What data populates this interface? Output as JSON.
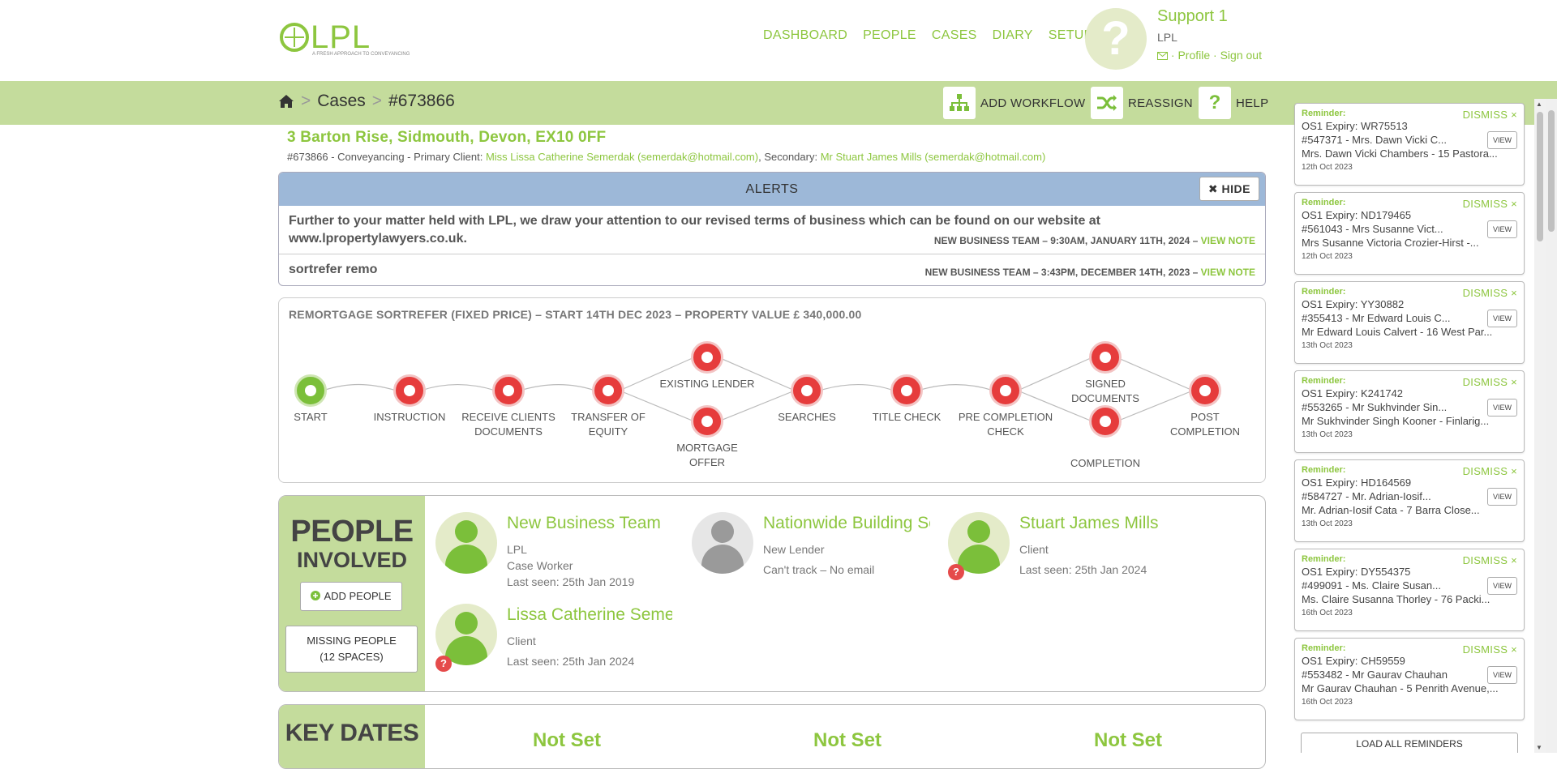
{
  "header": {
    "logo_text": "LPL",
    "logo_tagline": "A FRESH APPROACH TO CONVEYANCING",
    "nav": [
      "DASHBOARD",
      "PEOPLE",
      "CASES",
      "DIARY",
      "SETUP"
    ],
    "user": {
      "name": "Support 1",
      "org": "LPL",
      "profile": "Profile",
      "signout": "Sign out",
      "sep": "·"
    }
  },
  "breadcrumb": {
    "cases": "Cases",
    "case_id": "#673866",
    "sep": ">"
  },
  "actions": {
    "add_workflow": "ADD WORKFLOW",
    "reassign": "REASSIGN",
    "help": "HELP"
  },
  "case": {
    "address": "3 Barton Rise, Sidmouth, Devon, EX10 0FF",
    "sub_prefix": "#673866 - Conveyancing - Primary Client: ",
    "primary": "Miss Lissa Catherine Semerdak (semerdak@hotmail.com)",
    "sub_mid": ", Secondary: ",
    "secondary": "Mr Stuart James Mills (semerdak@hotmail.com)"
  },
  "alerts": {
    "title": "ALERTS",
    "hide": "HIDE",
    "items": [
      {
        "text": "Further to your matter held with LPL, we draw your attention to our revised terms of business which can be found on our website at www.lpropertylawyers.co.uk.",
        "meta": "NEW BUSINESS TEAM – 9:30AM, JANUARY 11TH, 2024 – ",
        "link": "VIEW NOTE"
      },
      {
        "text": "sortrefer remo",
        "meta": "NEW BUSINESS TEAM – 3:43PM, DECEMBER 14TH, 2023 – ",
        "link": "VIEW NOTE"
      }
    ]
  },
  "workflow": {
    "title": "REMORTGAGE SORTREFER (FIXED PRICE) – START 14TH DEC 2023 – PROPERTY VALUE £ 340,000.00",
    "nodes": [
      {
        "label": "START",
        "status": "done"
      },
      {
        "label": "INSTRUCTION",
        "status": "pending"
      },
      {
        "label": "RECEIVE CLIENTS DOCUMENTS",
        "status": "pending"
      },
      {
        "label": "TRANSFER OF EQUITY",
        "status": "pending"
      },
      {
        "label": "EXISTING LENDER",
        "status": "pending"
      },
      {
        "label": "MORTGAGE OFFER",
        "status": "pending"
      },
      {
        "label": "SEARCHES",
        "status": "pending"
      },
      {
        "label": "TITLE CHECK",
        "status": "pending"
      },
      {
        "label": "PRE COMPLETION CHECK",
        "status": "pending"
      },
      {
        "label": "SIGNED DOCUMENTS",
        "status": "pending"
      },
      {
        "label": "COMPLETION",
        "status": "pending"
      },
      {
        "label": "POST COMPLETION",
        "status": "pending"
      }
    ]
  },
  "people": {
    "title1": "PEOPLE",
    "title2": "INVOLVED",
    "add_people": "ADD PEOPLE",
    "missing1": "MISSING PEOPLE",
    "missing2": "(12 SPACES)",
    "items": [
      {
        "name": "New Business Team",
        "line1": "LPL",
        "line2": "Case Worker",
        "line3": "Last seen: 25th Jan 2019",
        "avatar": "green",
        "warn": false
      },
      {
        "name": "Nationwide Building Society",
        "line1": "New Lender",
        "line2": "Can't track – No email",
        "line3": "",
        "avatar": "grey",
        "warn": false
      },
      {
        "name": "Stuart James Mills",
        "line1": "Client",
        "line2": "Last seen: 25th Jan 2024",
        "line3": "",
        "avatar": "green",
        "warn": true
      },
      {
        "name": "Lissa Catherine Semerdak",
        "line1": "Client",
        "line2": "Last seen: 25th Jan 2024",
        "line3": "",
        "avatar": "green",
        "warn": true
      }
    ]
  },
  "key_dates": {
    "title": "KEY DATES",
    "values": [
      "Not Set",
      "Not Set",
      "Not Set"
    ]
  },
  "reminders": {
    "label": "Reminder:",
    "dismiss": "DISMISS",
    "view": "VIEW",
    "load_all": "LOAD ALL REMINDERS",
    "items": [
      {
        "l1": "OS1 Expiry: WR75513",
        "l2": "#547371 - Mrs. Dawn Vicki C...",
        "l3": "Mrs. Dawn Vicki Chambers - 15 Pastora...",
        "date": "12th Oct 2023"
      },
      {
        "l1": "OS1 Expiry: ND179465",
        "l2": "#561043 - Mrs Susanne Vict...",
        "l3": "Mrs Susanne Victoria Crozier-Hirst -...",
        "date": "12th Oct 2023"
      },
      {
        "l1": "OS1 Expiry: YY30882",
        "l2": "#355413 - Mr Edward Louis C...",
        "l3": "Mr Edward Louis Calvert - 16 West Par...",
        "date": "13th Oct 2023"
      },
      {
        "l1": "OS1 Expiry: K241742",
        "l2": "#553265 - Mr Sukhvinder Sin...",
        "l3": "Mr Sukhvinder Singh Kooner - Finlarig...",
        "date": "13th Oct 2023"
      },
      {
        "l1": "OS1 Expiry: HD164569",
        "l2": "#584727 - Mr. Adrian-Iosif...",
        "l3": "Mr. Adrian-Iosif Cata - 7 Barra Close...",
        "date": "13th Oct 2023"
      },
      {
        "l1": "OS1 Expiry: DY554375",
        "l2": "#499091 - Ms. Claire Susan...",
        "l3": "Ms. Claire Susanna Thorley - 76 Packi...",
        "date": "16th Oct 2023"
      },
      {
        "l1": "OS1 Expiry: CH59559",
        "l2": "#553482 - Mr Gaurav Chauhan",
        "l3": "Mr Gaurav Chauhan - 5 Penrith Avenue,...",
        "date": "16th Oct 2023"
      }
    ]
  },
  "colors": {
    "brand_green": "#8dc63f",
    "bar_green": "#c4dc9c",
    "alert_blue": "#9db8d8",
    "node_red": "#e63c3c"
  }
}
